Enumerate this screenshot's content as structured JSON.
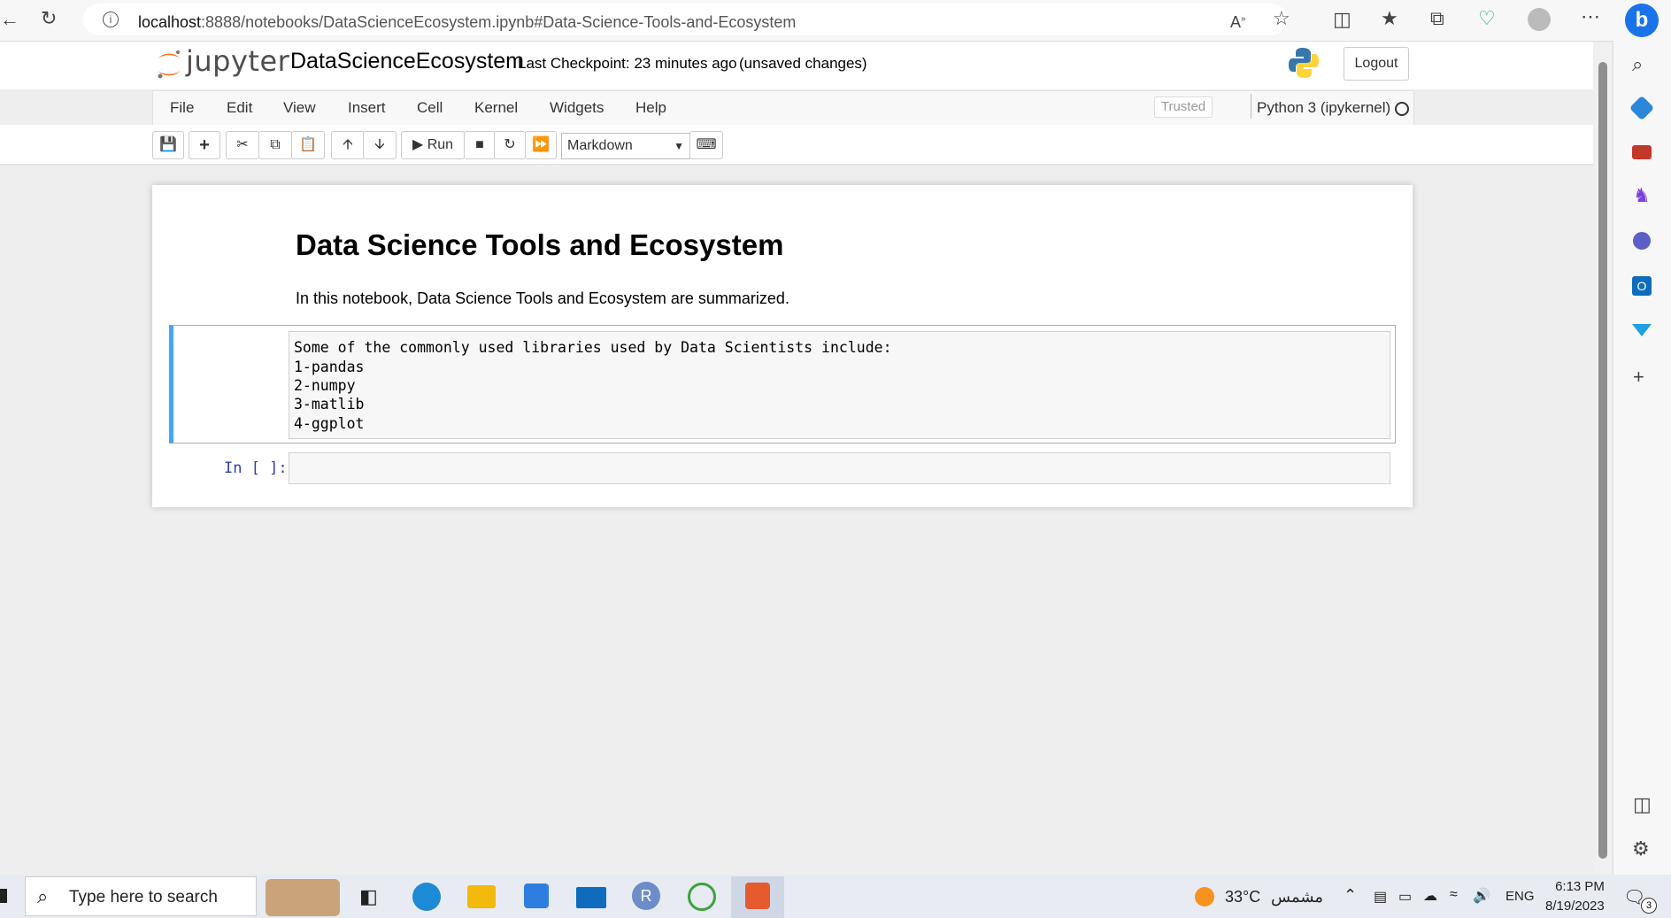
{
  "browser": {
    "url_host": "localhost",
    "url_path": ":8888/notebooks/DataScienceEcosystem.ipynb#Data-Science-Tools-and-Ecosystem"
  },
  "jupyter": {
    "logo_text": "jupyter",
    "notebook_name": "DataScienceEcosystem",
    "checkpoint": "Last Checkpoint: 23 minutes ago",
    "unsaved": "(unsaved changes)",
    "logout_label": "Logout",
    "menu": [
      "File",
      "Edit",
      "View",
      "Insert",
      "Cell",
      "Kernel",
      "Widgets",
      "Help"
    ],
    "trusted_label": "Trusted",
    "kernel_name": "Python 3 (ipykernel)",
    "toolbar": {
      "run_label": "Run",
      "cell_type": "Markdown"
    }
  },
  "notebook": {
    "heading": "Data Science Tools and Ecosystem",
    "intro": "In this notebook, Data Science Tools and Ecosystem are summarized.",
    "md_lines": [
      "Some of the commonly used libraries used by Data Scientists include:",
      "1-pandas",
      "2-numpy",
      "3-matlib",
      "4-ggplot"
    ],
    "code_prompt": "In [ ]:"
  },
  "taskbar": {
    "search_placeholder": "Type here to search",
    "weather": "33°C",
    "weather_text": "مشمس",
    "lang": "ENG",
    "time": "6:13 PM",
    "date": "8/19/2023",
    "notif_count": "3"
  },
  "colors": {
    "accent_cell": "#42a5f5",
    "jupyter_orange": "#f37726"
  }
}
